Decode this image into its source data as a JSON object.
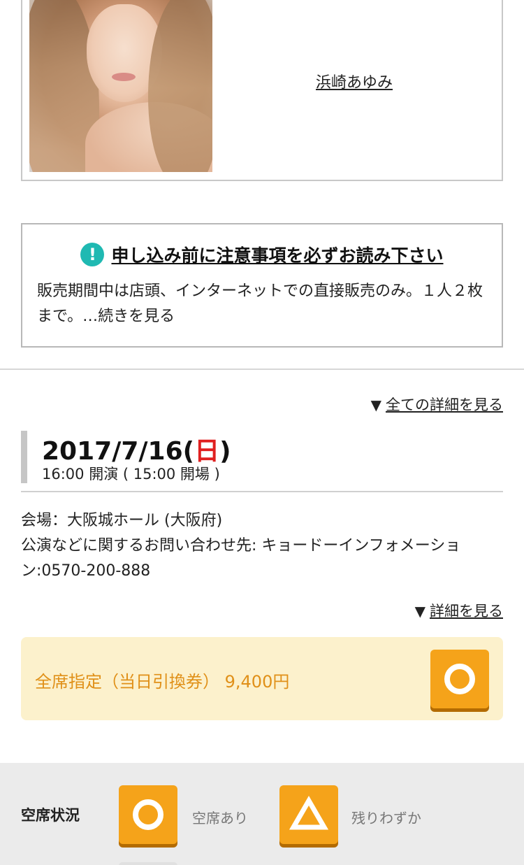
{
  "artist": {
    "name": "浜崎あゆみ"
  },
  "notice": {
    "icon": "!",
    "title": "申し込み前に注意事項を必ずお読み下さい",
    "body": "販売期間中は店頭、インターネットでの直接販売のみ。１人２枚まで。…続きを見る",
    "accent_color": "#1fb9b2"
  },
  "event": {
    "all_details_arrow": "▼",
    "all_details_link": "全ての詳細を見る",
    "date_prefix": "2017/7/16(",
    "day_of_week": "日",
    "date_suffix": ")",
    "time": "16:00 開演 ( 15:00 開場 )",
    "venue": "会場：大阪城ホール (大阪府)",
    "contact": "公演などに関するお問い合わせ先: キョードーインフォメーション:0570-200-888",
    "details_arrow": "▼",
    "details_link": "詳細を見る"
  },
  "ticket": {
    "label": "全席指定（当日引換券）",
    "price": "9,400円",
    "status_icon": "circle-mark",
    "accent_color": "#f5a31a"
  },
  "legend": {
    "title": "空席状況",
    "items": [
      {
        "icon": "circle-mark",
        "label": "空席あり"
      },
      {
        "icon": "triangle-mark",
        "label": "残りわずか"
      }
    ]
  }
}
